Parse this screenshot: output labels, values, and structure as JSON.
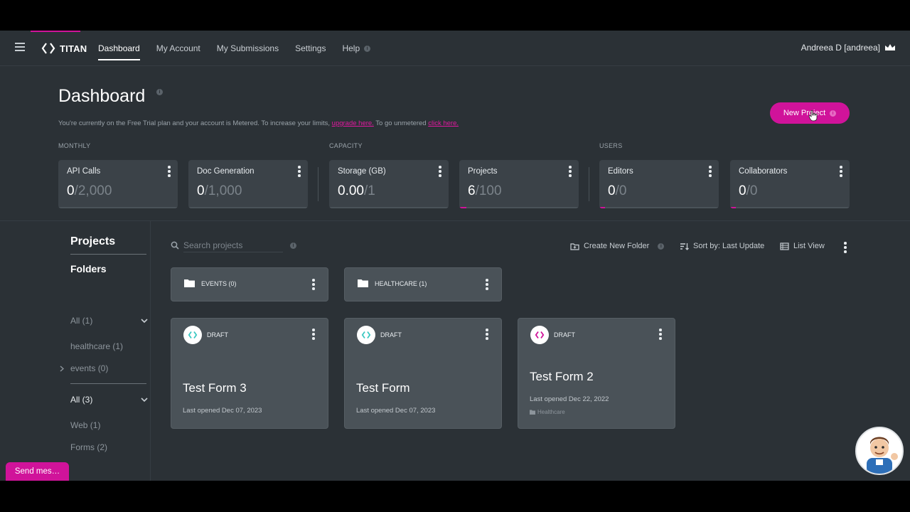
{
  "nav": {
    "brand": "TITAN",
    "links": [
      "Dashboard",
      "My Account",
      "My Submissions",
      "Settings",
      "Help"
    ],
    "user": "Andreea D [andreea]"
  },
  "header": {
    "title": "Dashboard",
    "note_prefix": "You're currently on the Free Trial plan and your account is Metered. To increase your limits, ",
    "upgrade_link": "upgrade here.",
    "note_middle": " To go unmetered ",
    "unmetered_link": "click here.",
    "new_project": "New Project"
  },
  "sections": {
    "monthly": "MONTHLY",
    "capacity": "CAPACITY",
    "users": "USERS"
  },
  "stats": [
    {
      "label": "API Calls",
      "value": "0",
      "limit": "/2,000",
      "fraction": 0
    },
    {
      "label": "Doc Generation",
      "value": "0",
      "limit": "/1,000",
      "fraction": 0
    },
    {
      "label": "Storage (GB)",
      "value": "0.00",
      "limit": "/1",
      "fraction": 0
    },
    {
      "label": "Projects",
      "value": "6",
      "limit": "/100",
      "fraction": 0.06
    },
    {
      "label": "Editors",
      "value": "0",
      "limit": "/0",
      "fraction": 0.05
    },
    {
      "label": "Collaborators",
      "value": "0",
      "limit": "/0",
      "fraction": 0.05
    }
  ],
  "sidebar": {
    "title": "Projects",
    "folders_title": "Folders",
    "folder_items": [
      "All (1)",
      "healthcare (1)",
      "events (0)"
    ],
    "type_items": [
      "All (3)",
      "Web (1)",
      "Forms (2)"
    ]
  },
  "toolbar": {
    "search_placeholder": "Search projects",
    "create_folder": "Create New Folder",
    "sort": "Sort by: Last Update",
    "view": "List View"
  },
  "folders": [
    {
      "name": "EVENTS (0)"
    },
    {
      "name": "HEALTHCARE (1)"
    }
  ],
  "projects": [
    {
      "status": "DRAFT",
      "name": "Test Form 3",
      "opened": "Last opened Dec 07, 2023",
      "tag": "",
      "kind": "form",
      "accent": "#3cc9c2"
    },
    {
      "status": "DRAFT",
      "name": "Test Form",
      "opened": "Last opened Dec 07, 2023",
      "tag": "",
      "kind": "form",
      "accent": "#3cc9c2"
    },
    {
      "status": "DRAFT",
      "name": "Test Form 2",
      "opened": "Last opened Dec 22, 2022",
      "tag": "Healthcare",
      "kind": "web",
      "accent": "#d0139a"
    }
  ],
  "chat": {
    "send_label": "Send mes…"
  },
  "colors": {
    "accent": "#d0139a",
    "background": "#2b3136",
    "card": "#4a5258"
  }
}
